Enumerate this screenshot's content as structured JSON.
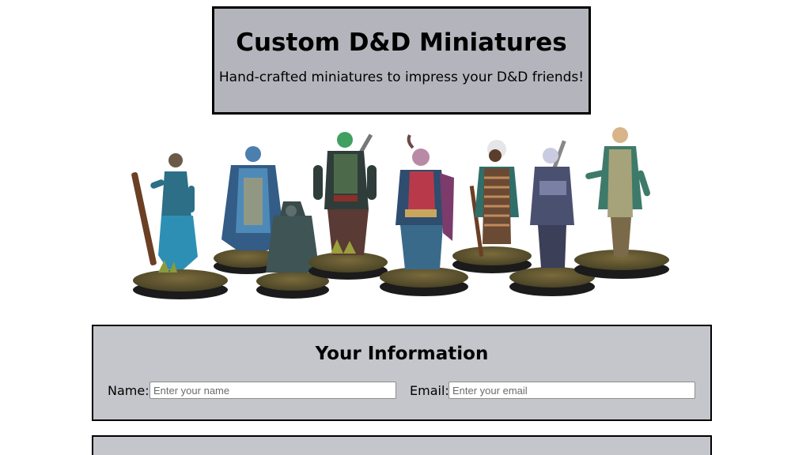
{
  "header": {
    "title": "Custom D&D Miniatures",
    "subtitle": "Hand-crafted miniatures to impress your D&D friends!"
  },
  "hero": {
    "alt": "Group of painted D&D miniature figures on round bases"
  },
  "info_section": {
    "title": "Your Information",
    "name_label": "Name:",
    "name_placeholder": "Enter your name",
    "name_value": "",
    "email_label": "Email:",
    "email_placeholder": "Enter your email",
    "email_value": ""
  },
  "colors": {
    "header_bg": "#b4b5bc",
    "section_bg": "#c5c6cc",
    "border": "#000000",
    "page_bg": "#ffffff"
  }
}
